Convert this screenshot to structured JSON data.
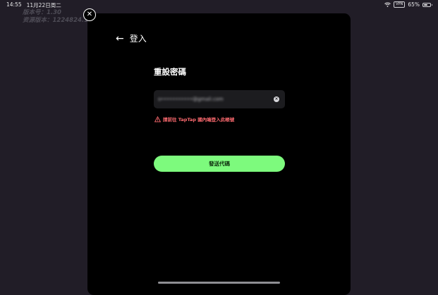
{
  "status_bar": {
    "time": "14:55",
    "date": "11月22日周二",
    "vpn": "VPN",
    "battery_percent": "65%",
    "battery_level": 0.65
  },
  "watermark": {
    "line1": "版本号：1.30",
    "line2": "资源版本：1224824.1…"
  },
  "header": {
    "back_label": "登入"
  },
  "form": {
    "title": "重設密碼",
    "email_value": "s•••••••••••@gmail.com",
    "error_text": "請前往 TapTap 國內端登入此帳號",
    "send_button_label": "發送代碼"
  },
  "colors": {
    "accent": "#7dfa7d",
    "error": "#ff6b70",
    "modal_background": "#000000",
    "page_background": "#211d27"
  },
  "icons": [
    "wifi-icon",
    "battery-icon",
    "close-icon",
    "back-arrow-icon",
    "clear-icon",
    "warning-icon"
  ]
}
